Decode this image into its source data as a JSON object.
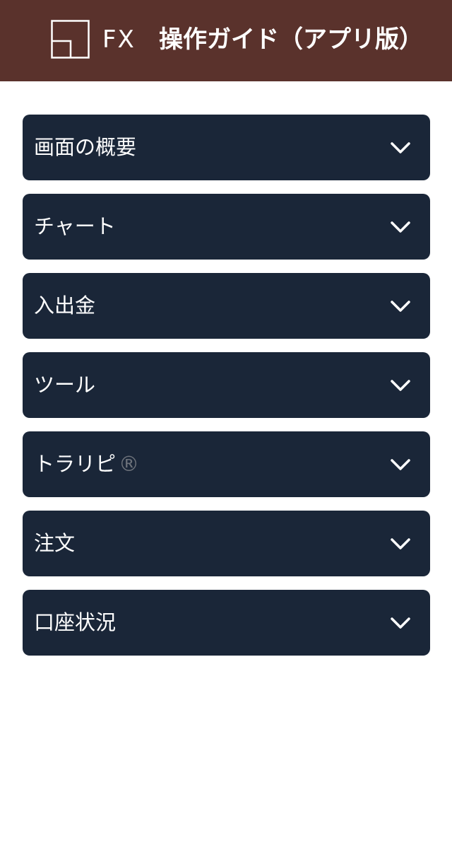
{
  "header": {
    "logo_text": "FX",
    "title": "操作ガイド（アプリ版）",
    "background_color": "#5a322c"
  },
  "menu": {
    "item_color": "#1a2638",
    "items": [
      {
        "label": "画面の概要",
        "icon": "chevron-down-icon"
      },
      {
        "label": "チャート",
        "icon": "chevron-down-icon"
      },
      {
        "label": "入出金",
        "icon": "chevron-down-icon"
      },
      {
        "label": "ツール",
        "icon": "chevron-down-icon"
      },
      {
        "label": "トラリピ",
        "mark": "®",
        "icon": "chevron-down-icon"
      },
      {
        "label": "注文",
        "icon": "chevron-down-icon"
      },
      {
        "label": "口座状況",
        "icon": "chevron-down-icon"
      }
    ]
  }
}
